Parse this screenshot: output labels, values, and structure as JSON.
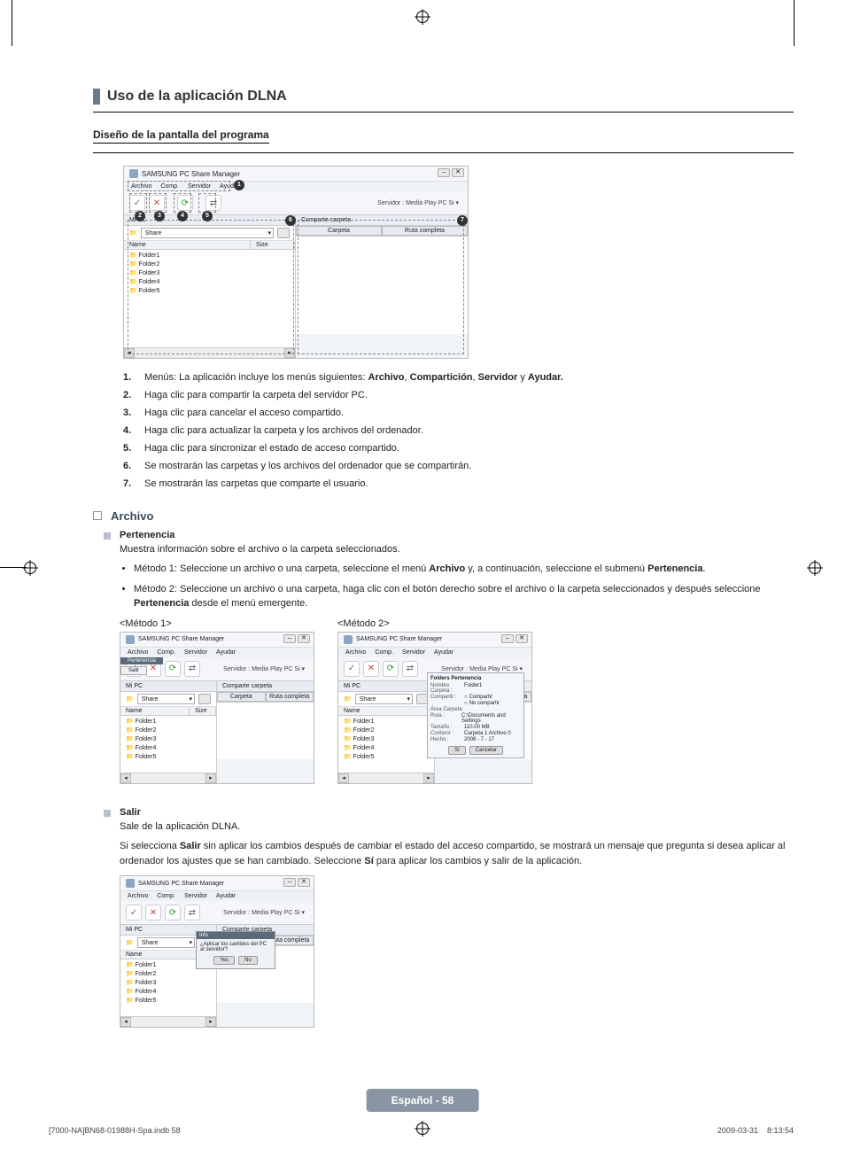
{
  "page": {
    "section_title": "Uso de la aplicación DLNA",
    "subsection_title": "Diseño de la pantalla del programa",
    "page_badge": "Español - 58",
    "footer_left": "[7000-NA]BN68-01988H-Spa.indb   58",
    "footer_right": "2009-03-31      8:13:54"
  },
  "app": {
    "title": "SAMSUNG PC Share Manager",
    "menu": {
      "archivo": "Archivo",
      "comp": "Comp.",
      "servidor": "Servidor",
      "ayudar": "Ayudar"
    },
    "server_label": "Servidor :  Media Play PC Si  ▾",
    "left": {
      "head": "Mi PC",
      "breadcrumb": "Share",
      "cols": {
        "name": "Name",
        "size": "Size"
      },
      "folders": [
        "Folder1",
        "Folder2",
        "Folder3",
        "Folder4",
        "Folder5"
      ]
    },
    "right": {
      "head": "Comparte carpeta",
      "cols": {
        "carpeta": "Carpeta",
        "ruta": "Ruta completa"
      }
    }
  },
  "callouts": {
    "c1": "1",
    "c2": "2",
    "c3": "3",
    "c4": "4",
    "c5": "5",
    "c6": "6",
    "c7": "7"
  },
  "numbered": {
    "n1_pre": "Menús: La aplicación incluye los menús siguientes: ",
    "n1_b1": "Archivo",
    "n1_s1": ", ",
    "n1_b2": "Compartición",
    "n1_s2": ", ",
    "n1_b3": "Servidor",
    "n1_s3": " y ",
    "n1_b4": "Ayudar.",
    "n2": "Haga clic para compartir la carpeta del servidor PC.",
    "n3": "Haga clic para cancelar el acceso compartido.",
    "n4": "Haga clic para actualizar la carpeta y los archivos del ordenador.",
    "n5": "Haga clic para sincronizar el estado de acceso compartido.",
    "n6": "Se mostrarán las carpetas y los archivos del ordenador que se compartirán.",
    "n7": "Se mostrarán las carpetas que comparte el usuario."
  },
  "archivo": {
    "heading": "Archivo",
    "pertenencia": {
      "title": "Pertenencia",
      "desc": "Muestra información sobre el archivo o la carpeta seleccionados.",
      "m1_pre": "Método 1: Seleccione un archivo o una carpeta, seleccione el menú ",
      "m1_b1": "Archivo",
      "m1_mid": " y, a continuación, seleccione el submenú ",
      "m1_b2": "Pertenencia",
      "m1_post": ".",
      "m2_pre": "Método 2: Seleccione un archivo o una carpeta, haga clic con el botón derecho sobre el archivo o la carpeta seleccionados y después seleccione ",
      "m2_b1": "Pertenencia",
      "m2_post": " desde el menú emergente.",
      "label1": "<Método 1>",
      "label2": "<Método 2>"
    },
    "salir": {
      "title": "Salir",
      "line1": "Sale de la aplicación DLNA.",
      "line2_pre": "Si selecciona ",
      "line2_b1": "Salir",
      "line2_mid": " sin aplicar los cambios después de cambiar el estado del acceso compartido, se mostrará un mensaje que pregunta si desea aplicar al ordenador los ajustes que se han cambiado. Seleccione ",
      "line2_b2": "Sí",
      "line2_post": " para aplicar los cambios y salir de la aplicación."
    }
  },
  "prop_panel": {
    "title": "Folders  Pertenencia",
    "r1_l": "Nombre Carpeta :",
    "r1_v": "Folder1",
    "r2_l": "Compartir :",
    "r2_o1": "Compartir",
    "r2_o2": "No compartir",
    "r3_l": "Área Carpeta",
    "r4_l": "Ruta :",
    "r4_v": "C:\\Documents and Settings",
    "r5_l": "Tamaño :",
    "r5_v": "110.00 MB",
    "r6_l": "Contenir :",
    "r6_v": "Carpeta  1  Archivo  0",
    "r7_l": "Hecho :",
    "r7_v": "2008 - 7 - 17",
    "ok": "Sí",
    "cancel": "Cancelar"
  },
  "exit_modal": {
    "title": "Info",
    "msg": "¿Aplicar los cambios del PC al servidor?",
    "yes": "Yes",
    "no": "No"
  },
  "menu_drop": {
    "item": "Pertenencia",
    "exit_item": "Salir"
  }
}
